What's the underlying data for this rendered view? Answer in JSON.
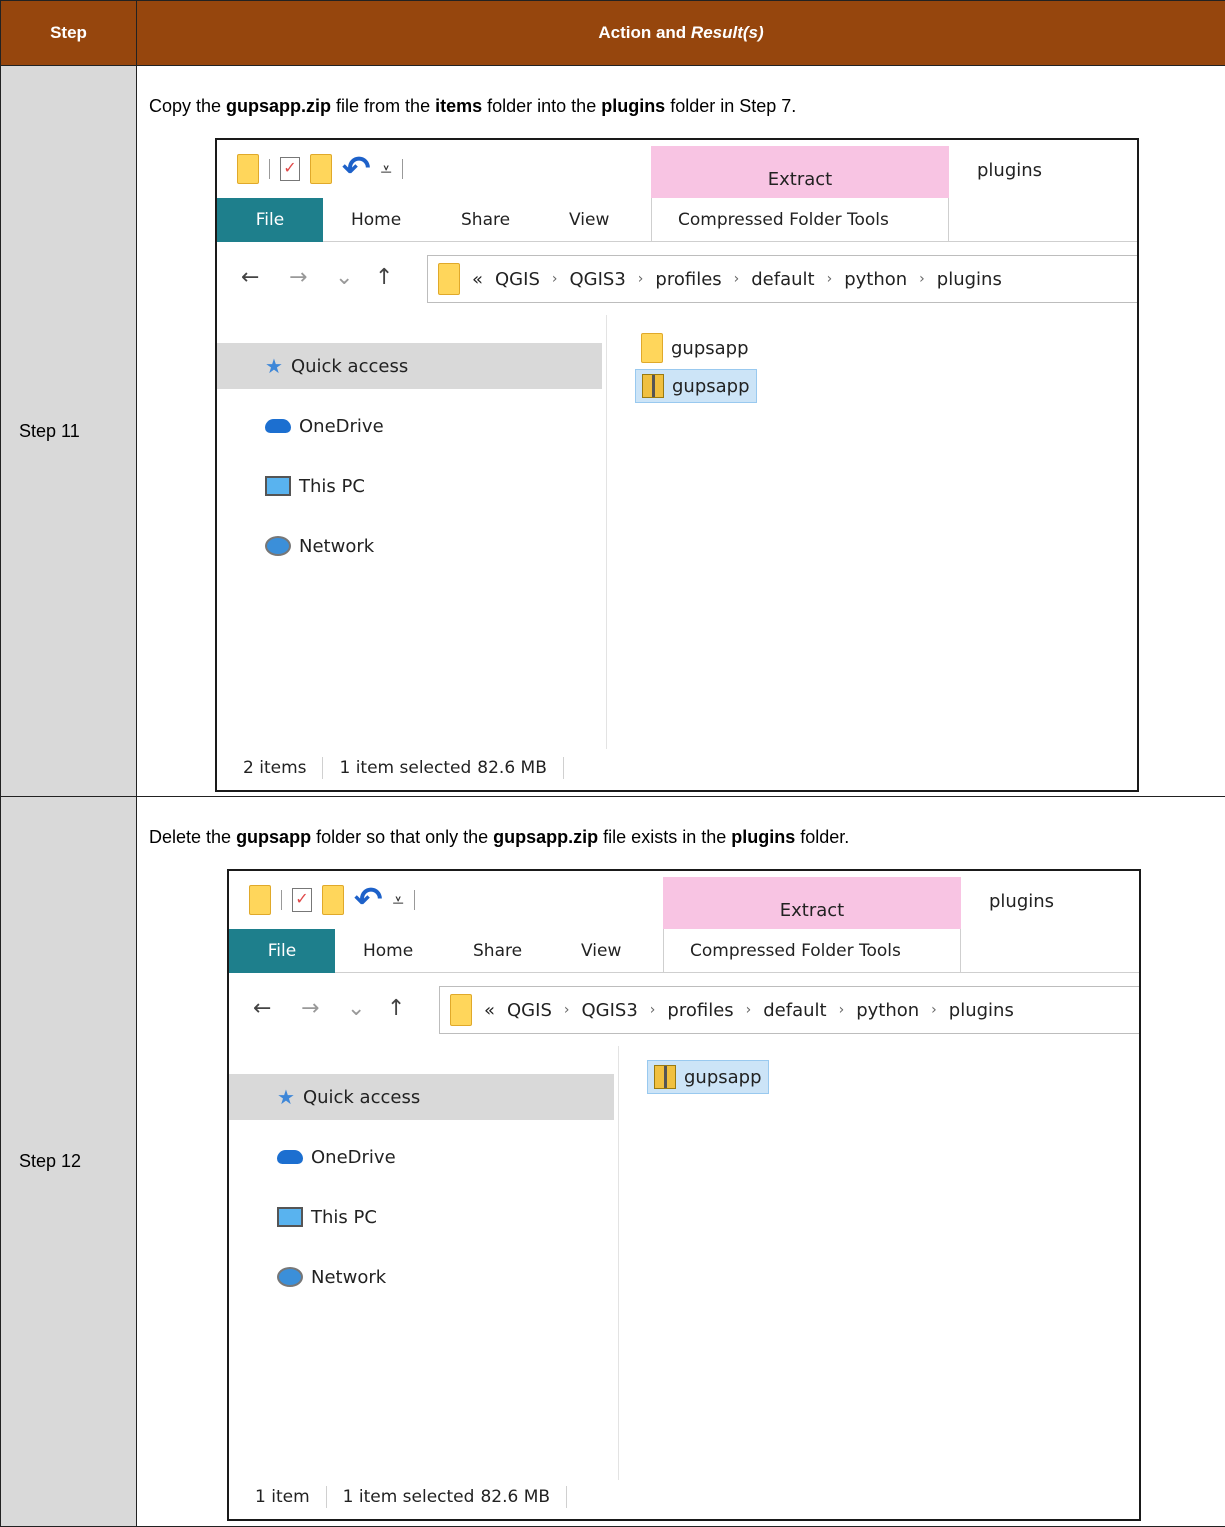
{
  "table": {
    "header_step": "Step",
    "header_action": "Action and",
    "header_result": "Result(s)"
  },
  "rows": [
    {
      "step": "Step 11",
      "instruction": [
        {
          "text": "Copy the ",
          "bold": false
        },
        {
          "text": "gupsapp.zip",
          "bold": true
        },
        {
          "text": " file from the ",
          "bold": false
        },
        {
          "text": "items",
          "bold": true
        },
        {
          "text": " folder into the ",
          "bold": false
        },
        {
          "text": "plugins",
          "bold": true
        },
        {
          "text": " folder in Step 7.",
          "bold": false
        }
      ],
      "window": {
        "title": "plugins",
        "context_tab": "Extract",
        "context_group": "Compressed Folder Tools",
        "tabs": [
          "File",
          "Home",
          "Share",
          "View"
        ],
        "breadcrumb_prefix": "«",
        "breadcrumb": [
          "QGIS",
          "QGIS3",
          "profiles",
          "default",
          "python",
          "plugins"
        ],
        "nav": [
          "Quick access",
          "OneDrive",
          "This PC",
          "Network"
        ],
        "files": [
          {
            "name": "gupsapp",
            "type": "folder",
            "selected": false
          },
          {
            "name": "gupsapp",
            "type": "zip",
            "selected": true
          }
        ],
        "status_count": "2 items",
        "status_selected": "1 item selected",
        "status_size": "82.6 MB"
      }
    },
    {
      "step": "Step 12",
      "instruction": [
        {
          "text": "Delete the ",
          "bold": false
        },
        {
          "text": "gupsapp",
          "bold": true
        },
        {
          "text": " folder so that only the ",
          "bold": false
        },
        {
          "text": "gupsapp.zip",
          "bold": true
        },
        {
          "text": " file exists in the ",
          "bold": false
        },
        {
          "text": "plugins",
          "bold": true
        },
        {
          "text": " folder.",
          "bold": false
        }
      ],
      "window": {
        "title": "plugins",
        "context_tab": "Extract",
        "context_group": "Compressed Folder Tools",
        "tabs": [
          "File",
          "Home",
          "Share",
          "View"
        ],
        "breadcrumb_prefix": "«",
        "breadcrumb": [
          "QGIS",
          "QGIS3",
          "profiles",
          "default",
          "python",
          "plugins"
        ],
        "nav": [
          "Quick access",
          "OneDrive",
          "This PC",
          "Network"
        ],
        "files": [
          {
            "name": "gupsapp",
            "type": "zip",
            "selected": true
          }
        ],
        "status_count": "1 item",
        "status_selected": "1 item selected",
        "status_size": "82.6 MB"
      }
    }
  ],
  "icons": {
    "back": "arrow-left-icon",
    "forward": "arrow-right-icon",
    "recent": "chevron-down-icon",
    "up": "arrow-up-icon"
  },
  "colors": {
    "header_bg": "#96460d",
    "step_bg": "#d9d9d9",
    "file_tab": "#1e7f8c",
    "extract_bg": "#f8c4e3",
    "selection_bg": "#cce4f7"
  }
}
